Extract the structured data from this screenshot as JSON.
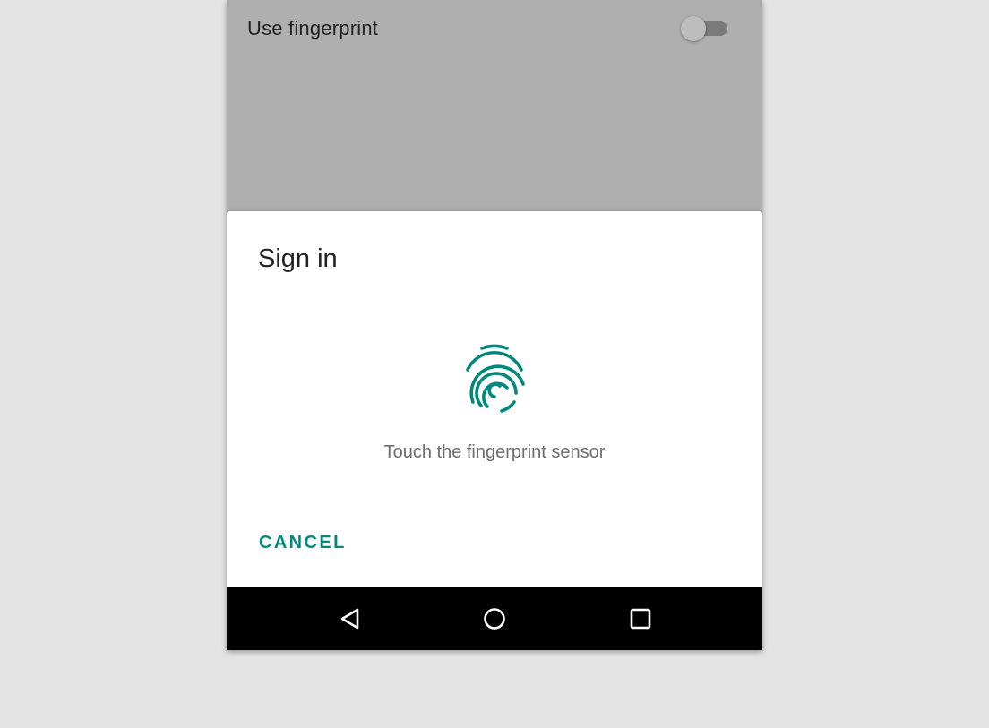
{
  "settings": {
    "use_fingerprint_label": "Use fingerprint",
    "use_fingerprint_enabled": false
  },
  "dialog": {
    "title": "Sign in",
    "icon": "fingerprint-icon",
    "hint": "Touch the fingerprint sensor",
    "cancel_label": "CANCEL",
    "accent_color": "#00897b"
  },
  "navbar": {
    "back_icon": "back-triangle-icon",
    "home_icon": "home-circle-icon",
    "recents_icon": "recents-square-icon"
  }
}
